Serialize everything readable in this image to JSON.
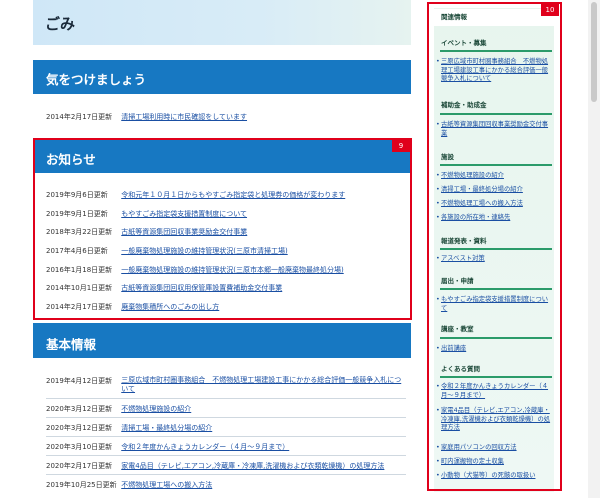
{
  "sections": {
    "gomi": {
      "title": "ごみ"
    },
    "kiwotsukemasho": {
      "title": "気をつけましょう"
    },
    "oshirase": {
      "title": "お知らせ"
    },
    "kihon": {
      "title": "基本情報"
    }
  },
  "kiwotsuke_items": [
    {
      "date": "2014年2月17日更新",
      "title": "清掃工場利用時に市民確認をしています"
    }
  ],
  "oshirase_items": [
    {
      "date": "2019年9月6日更新",
      "title": "令和元年１０月１日からもやすごみ指定袋と処理券の価格が変わります"
    },
    {
      "date": "2019年9月1日更新",
      "title": "もやすごみ指定袋支援措置制度について"
    },
    {
      "date": "2018年3月22日更新",
      "title": "古紙等資源集団回収事業奨励金交付事業"
    },
    {
      "date": "2017年4月6日更新",
      "title": "一般廃棄物処理施設の維持管理状況(三原市清掃工場)"
    },
    {
      "date": "2016年1月18日更新",
      "title": "一般廃棄物処理施設の維持管理状況(三原市本郷一般廃棄物最終処分場)"
    },
    {
      "date": "2014年10月1日更新",
      "title": "古紙等資源集団回収用保管庫設置費補助金交付事業"
    },
    {
      "date": "2014年2月17日更新",
      "title": "廃棄物集積所へのごみの出し方"
    }
  ],
  "kihon_items": [
    {
      "date": "2019年4月12日更新",
      "title": "三原広域市町村圏事務組合　不燃物処理工場建設工事にかかる総合評価一般競争入札について"
    },
    {
      "date": "2020年3月12日更新",
      "title": "不燃物処理施設の紹介"
    },
    {
      "date": "2020年3月12日更新",
      "title": "清掃工場・最終処分場の紹介"
    },
    {
      "date": "2020年3月10日更新",
      "title": "令和２年度かんきょうカレンダー（４月～９月まで）"
    },
    {
      "date": "2020年2月17日更新",
      "title": "家電4品目（テレビ,エアコン,冷蔵庫・冷凍庫,洗濯機および衣類乾燥機）の処理方法"
    },
    {
      "date": "2019年10月25日更新",
      "title": "不燃物処理工場への搬入方法"
    }
  ],
  "badges": {
    "oshirase": "9",
    "sidebar": "10"
  },
  "sidebar": {
    "title": "関連情報",
    "groups": [
      {
        "heading": "イベント・募集",
        "links": [
          "三原広域市町村圏事務組合　不燃物処理工場建設工事にかかる総合評価一般競争入札について"
        ]
      },
      {
        "heading": "補助金・助成金",
        "links": [
          "古紙等資源集団回収事業奨励金交付事業"
        ]
      },
      {
        "heading": "施設",
        "links": [
          "不燃物処理施設の紹介",
          "清掃工場・最終処分場の紹介",
          "不燃物処理工場への搬入方法",
          "各施設の所在地・連絡先"
        ]
      },
      {
        "heading": "報道発表・資料",
        "links": [
          "アスベスト対策"
        ]
      },
      {
        "heading": "届出・申請",
        "links": [
          "もやすごみ指定袋支援措置制度について"
        ]
      },
      {
        "heading": "講座・教室",
        "links": [
          "出前講座"
        ]
      },
      {
        "heading": "よくある質問",
        "links": [
          "令和２年度かんきょうカレンダー（４月～９月まで）",
          "家電4品目（テレビ,エアコン,冷蔵庫・冷凍庫,洗濯機および衣類乾燥機）の処理方法",
          "家庭用パソコンの回収方法",
          "町内運搬物の定土収集",
          "小動物（犬猫等）の死骸の取扱い"
        ]
      }
    ]
  },
  "colors": {
    "band": "#1778c2",
    "highlight": "#e0001b",
    "sidebar_rule": "#2b9b6a"
  }
}
